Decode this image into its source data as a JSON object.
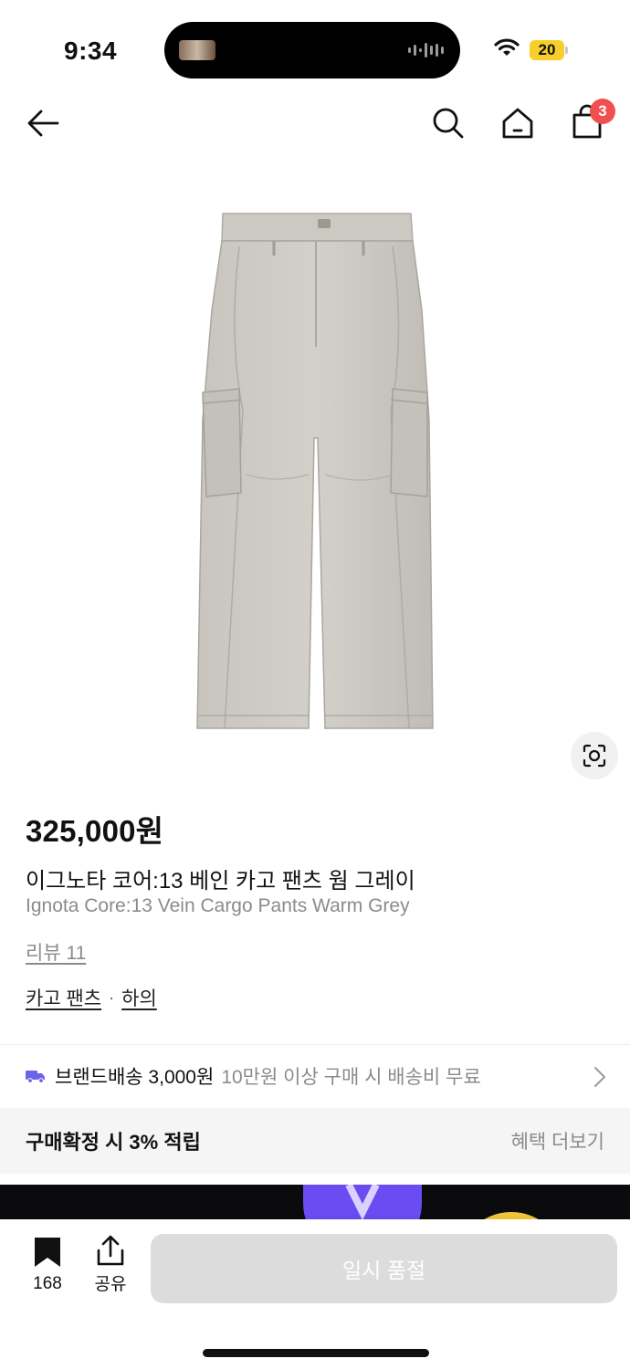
{
  "status_bar": {
    "time": "9:34",
    "battery": "20",
    "battery_color": "#f6cf2b",
    "icons": [
      "wifi-icon",
      "battery-icon"
    ]
  },
  "nav": {
    "icons": [
      "back-arrow-icon",
      "search-icon",
      "home-icon",
      "shopping-bag-icon"
    ],
    "cart_badge": "3",
    "badge_color": "#ef4f4f"
  },
  "product": {
    "image": "gray cargo pants",
    "price": "325,000원",
    "name_ko": "이그노타 코어:13 베인 카고 팬츠 웜 그레이",
    "name_en": "Ignota Core:13 Vein Cargo Pants Warm Grey",
    "review": "리뷰 11",
    "category": "카고 팬츠",
    "category_separator": "·",
    "parent_category": "하의"
  },
  "shipping": {
    "label": "브랜드배송 3,000원",
    "note": "10만원 이상 구매 시 배송비 무료",
    "icon": "truck-icon",
    "icon_color": "#6b63e8"
  },
  "benefit": {
    "label": "구매확정 시 3% 적립",
    "more": "혜택 더보기"
  },
  "bottom_bar": {
    "bookmark_count": "168",
    "share_label": "공유",
    "soldout_label": "일시 품절",
    "soldout_color": "#dcdcdc"
  }
}
